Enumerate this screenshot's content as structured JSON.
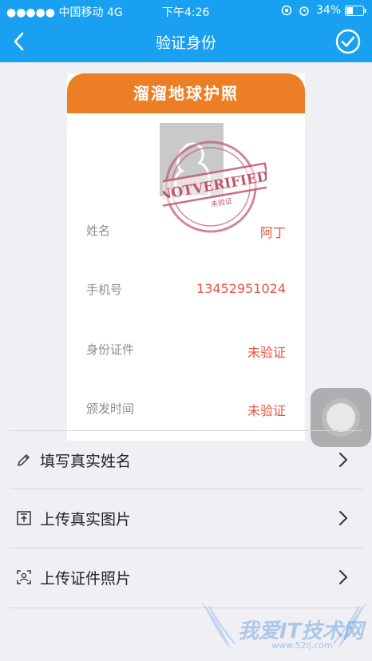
{
  "status_bar": {
    "signal": "●●●●● 中国移动   4G",
    "time": "下午4:26",
    "battery": "34%"
  },
  "nav": {
    "title": "验证身份",
    "back_icon": "chevron-left-icon",
    "confirm_icon": "check-circle-icon"
  },
  "card": {
    "title": "溜溜地球护照",
    "stamp_text": "NOTVERIFIED",
    "stamp_sub": "未验证",
    "rows": [
      {
        "label": "姓名",
        "value": "阿丁"
      },
      {
        "label": "手机号",
        "value": "13452951024"
      },
      {
        "label": "身份证件",
        "value": "未验证"
      },
      {
        "label": "颁发时间",
        "value": "未验证"
      }
    ]
  },
  "menu": [
    {
      "label": "填写真实姓名",
      "icon": "pencil-icon"
    },
    {
      "label": "上传真实图片",
      "icon": "upload-icon"
    },
    {
      "label": "上传证件照片",
      "icon": "id-scan-icon"
    }
  ],
  "watermark": {
    "text": "我爱IT技术网",
    "url": "www.52ij.com"
  },
  "colors": {
    "primary": "#1aa0f0",
    "card_header": "#ec7f26",
    "value_red": "#e8533f",
    "stamp": "#c0566c"
  }
}
